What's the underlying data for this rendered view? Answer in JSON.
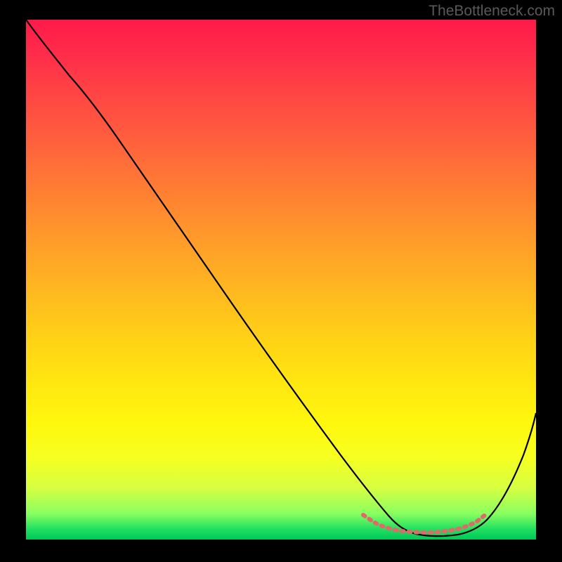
{
  "watermark": "TheBottleneck.com",
  "chart_data": {
    "type": "line",
    "title": "",
    "xlabel": "",
    "ylabel": "",
    "xlim": [
      0,
      100
    ],
    "ylim": [
      0,
      100
    ],
    "grid": false,
    "legend": false,
    "gradient_stops": [
      {
        "pos": 0,
        "color": "#ff1a4a"
      },
      {
        "pos": 50,
        "color": "#ffbd1e"
      },
      {
        "pos": 85,
        "color": "#f7ff20"
      },
      {
        "pos": 100,
        "color": "#00c858"
      }
    ],
    "series": [
      {
        "name": "bottleneck-curve",
        "color": "#000000",
        "x": [
          0,
          4,
          8,
          12,
          18,
          26,
          34,
          42,
          50,
          56,
          62,
          66,
          70,
          74,
          78,
          82,
          86,
          90,
          94,
          98,
          100
        ],
        "y": [
          100,
          96,
          92,
          88,
          80,
          69,
          58,
          47,
          36,
          27,
          18,
          11,
          6,
          2.5,
          1,
          1,
          2,
          6,
          14,
          26,
          34
        ]
      },
      {
        "name": "optimal-band",
        "color": "#e06a6a",
        "x": [
          66,
          70,
          74,
          78,
          82,
          86,
          88
        ],
        "y": [
          4,
          2.5,
          2,
          2,
          2,
          3,
          4
        ]
      }
    ],
    "annotations": []
  }
}
